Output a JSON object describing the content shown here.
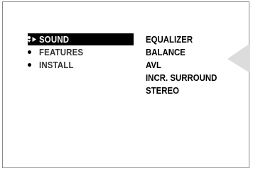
{
  "colors": {
    "background": "#ffffff",
    "text": "#000000",
    "selected_bg": "#000000",
    "selected_text": "#ffffff",
    "inactive_text": "#333333",
    "frame_border": "#8a8a8a",
    "decoration": "#dcdcdc"
  },
  "main_menu": {
    "items": [
      {
        "label": "SOUND",
        "selected": true,
        "icon": "cursor-arrow-icon"
      },
      {
        "label": "FEATURES",
        "selected": false,
        "icon": "bullet-icon"
      },
      {
        "label": "INSTALL",
        "selected": false,
        "icon": "bullet-icon"
      }
    ]
  },
  "sub_menu": {
    "items": [
      {
        "label": "EQUALIZER"
      },
      {
        "label": "BALANCE"
      },
      {
        "label": "AVL"
      },
      {
        "label": "INCR. SURROUND"
      },
      {
        "label": "STEREO"
      }
    ]
  }
}
